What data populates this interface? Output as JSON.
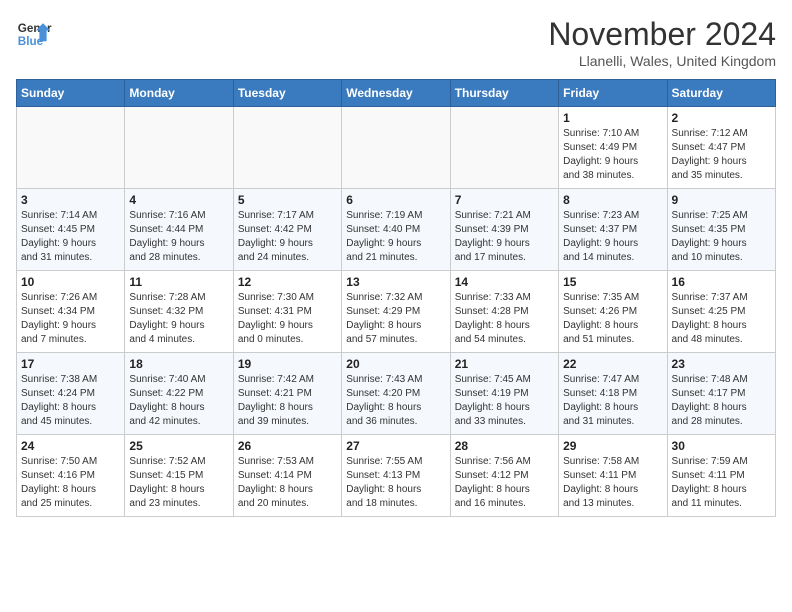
{
  "header": {
    "logo_line1": "General",
    "logo_line2": "Blue",
    "month": "November 2024",
    "location": "Llanelli, Wales, United Kingdom"
  },
  "weekdays": [
    "Sunday",
    "Monday",
    "Tuesday",
    "Wednesday",
    "Thursday",
    "Friday",
    "Saturday"
  ],
  "weeks": [
    [
      {
        "day": "",
        "info": ""
      },
      {
        "day": "",
        "info": ""
      },
      {
        "day": "",
        "info": ""
      },
      {
        "day": "",
        "info": ""
      },
      {
        "day": "",
        "info": ""
      },
      {
        "day": "1",
        "info": "Sunrise: 7:10 AM\nSunset: 4:49 PM\nDaylight: 9 hours\nand 38 minutes."
      },
      {
        "day": "2",
        "info": "Sunrise: 7:12 AM\nSunset: 4:47 PM\nDaylight: 9 hours\nand 35 minutes."
      }
    ],
    [
      {
        "day": "3",
        "info": "Sunrise: 7:14 AM\nSunset: 4:45 PM\nDaylight: 9 hours\nand 31 minutes."
      },
      {
        "day": "4",
        "info": "Sunrise: 7:16 AM\nSunset: 4:44 PM\nDaylight: 9 hours\nand 28 minutes."
      },
      {
        "day": "5",
        "info": "Sunrise: 7:17 AM\nSunset: 4:42 PM\nDaylight: 9 hours\nand 24 minutes."
      },
      {
        "day": "6",
        "info": "Sunrise: 7:19 AM\nSunset: 4:40 PM\nDaylight: 9 hours\nand 21 minutes."
      },
      {
        "day": "7",
        "info": "Sunrise: 7:21 AM\nSunset: 4:39 PM\nDaylight: 9 hours\nand 17 minutes."
      },
      {
        "day": "8",
        "info": "Sunrise: 7:23 AM\nSunset: 4:37 PM\nDaylight: 9 hours\nand 14 minutes."
      },
      {
        "day": "9",
        "info": "Sunrise: 7:25 AM\nSunset: 4:35 PM\nDaylight: 9 hours\nand 10 minutes."
      }
    ],
    [
      {
        "day": "10",
        "info": "Sunrise: 7:26 AM\nSunset: 4:34 PM\nDaylight: 9 hours\nand 7 minutes."
      },
      {
        "day": "11",
        "info": "Sunrise: 7:28 AM\nSunset: 4:32 PM\nDaylight: 9 hours\nand 4 minutes."
      },
      {
        "day": "12",
        "info": "Sunrise: 7:30 AM\nSunset: 4:31 PM\nDaylight: 9 hours\nand 0 minutes."
      },
      {
        "day": "13",
        "info": "Sunrise: 7:32 AM\nSunset: 4:29 PM\nDaylight: 8 hours\nand 57 minutes."
      },
      {
        "day": "14",
        "info": "Sunrise: 7:33 AM\nSunset: 4:28 PM\nDaylight: 8 hours\nand 54 minutes."
      },
      {
        "day": "15",
        "info": "Sunrise: 7:35 AM\nSunset: 4:26 PM\nDaylight: 8 hours\nand 51 minutes."
      },
      {
        "day": "16",
        "info": "Sunrise: 7:37 AM\nSunset: 4:25 PM\nDaylight: 8 hours\nand 48 minutes."
      }
    ],
    [
      {
        "day": "17",
        "info": "Sunrise: 7:38 AM\nSunset: 4:24 PM\nDaylight: 8 hours\nand 45 minutes."
      },
      {
        "day": "18",
        "info": "Sunrise: 7:40 AM\nSunset: 4:22 PM\nDaylight: 8 hours\nand 42 minutes."
      },
      {
        "day": "19",
        "info": "Sunrise: 7:42 AM\nSunset: 4:21 PM\nDaylight: 8 hours\nand 39 minutes."
      },
      {
        "day": "20",
        "info": "Sunrise: 7:43 AM\nSunset: 4:20 PM\nDaylight: 8 hours\nand 36 minutes."
      },
      {
        "day": "21",
        "info": "Sunrise: 7:45 AM\nSunset: 4:19 PM\nDaylight: 8 hours\nand 33 minutes."
      },
      {
        "day": "22",
        "info": "Sunrise: 7:47 AM\nSunset: 4:18 PM\nDaylight: 8 hours\nand 31 minutes."
      },
      {
        "day": "23",
        "info": "Sunrise: 7:48 AM\nSunset: 4:17 PM\nDaylight: 8 hours\nand 28 minutes."
      }
    ],
    [
      {
        "day": "24",
        "info": "Sunrise: 7:50 AM\nSunset: 4:16 PM\nDaylight: 8 hours\nand 25 minutes."
      },
      {
        "day": "25",
        "info": "Sunrise: 7:52 AM\nSunset: 4:15 PM\nDaylight: 8 hours\nand 23 minutes."
      },
      {
        "day": "26",
        "info": "Sunrise: 7:53 AM\nSunset: 4:14 PM\nDaylight: 8 hours\nand 20 minutes."
      },
      {
        "day": "27",
        "info": "Sunrise: 7:55 AM\nSunset: 4:13 PM\nDaylight: 8 hours\nand 18 minutes."
      },
      {
        "day": "28",
        "info": "Sunrise: 7:56 AM\nSunset: 4:12 PM\nDaylight: 8 hours\nand 16 minutes."
      },
      {
        "day": "29",
        "info": "Sunrise: 7:58 AM\nSunset: 4:11 PM\nDaylight: 8 hours\nand 13 minutes."
      },
      {
        "day": "30",
        "info": "Sunrise: 7:59 AM\nSunset: 4:11 PM\nDaylight: 8 hours\nand 11 minutes."
      }
    ]
  ]
}
